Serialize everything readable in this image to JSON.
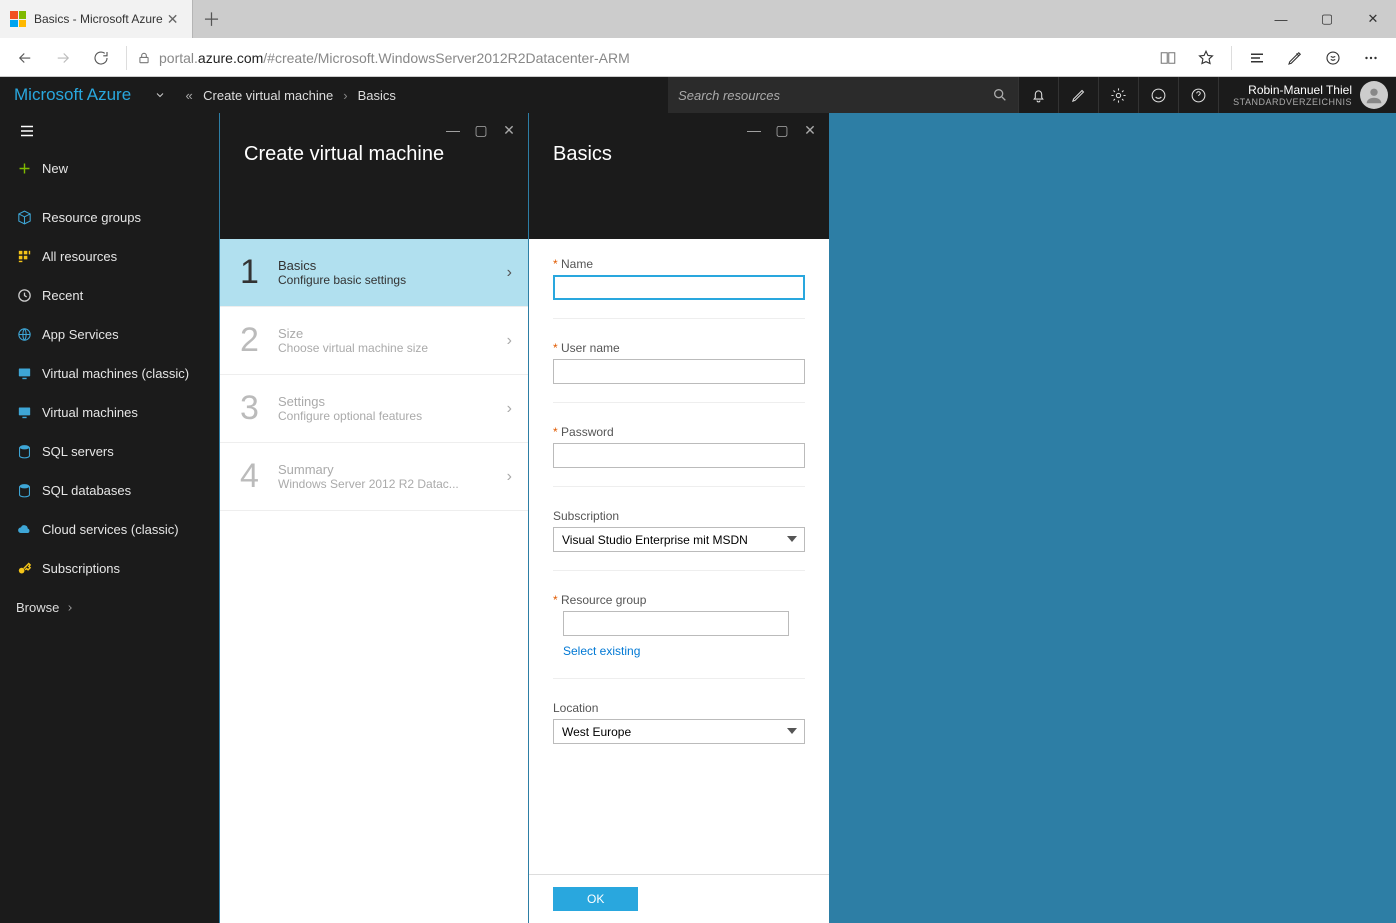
{
  "browser": {
    "tab_title": "Basics - Microsoft Azure",
    "url_prefix": "portal.",
    "url_strong": "azure.com",
    "url_suffix": "/#create/Microsoft.WindowsServer2012R2Datacenter-ARM"
  },
  "topbar": {
    "brand": "Microsoft Azure",
    "breadcrumb": [
      "Create virtual machine",
      "Basics"
    ],
    "search_placeholder": "Search resources",
    "user_name": "Robin-Manuel Thiel",
    "user_directory": "STANDARDVERZEICHNIS"
  },
  "sidebar": {
    "new": "New",
    "items": [
      {
        "label": "Resource groups"
      },
      {
        "label": "All resources"
      },
      {
        "label": "Recent"
      },
      {
        "label": "App Services"
      },
      {
        "label": "Virtual machines (classic)"
      },
      {
        "label": "Virtual machines"
      },
      {
        "label": "SQL servers"
      },
      {
        "label": "SQL databases"
      },
      {
        "label": "Cloud services (classic)"
      },
      {
        "label": "Subscriptions"
      }
    ],
    "browse": "Browse"
  },
  "blade1": {
    "title": "Create virtual machine",
    "steps": [
      {
        "num": "1",
        "title": "Basics",
        "sub": "Configure basic settings"
      },
      {
        "num": "2",
        "title": "Size",
        "sub": "Choose virtual machine size"
      },
      {
        "num": "3",
        "title": "Settings",
        "sub": "Configure optional features"
      },
      {
        "num": "4",
        "title": "Summary",
        "sub": "Windows Server 2012 R2 Datac..."
      }
    ]
  },
  "blade2": {
    "title": "Basics",
    "name_label": "Name",
    "name_value": "",
    "user_label": "User name",
    "user_value": "",
    "pass_label": "Password",
    "pass_value": "",
    "sub_label": "Subscription",
    "sub_value": "Visual Studio Enterprise mit MSDN",
    "rg_label": "Resource group",
    "rg_value": "",
    "rg_link": "Select existing",
    "loc_label": "Location",
    "loc_value": "West Europe",
    "ok": "OK"
  }
}
